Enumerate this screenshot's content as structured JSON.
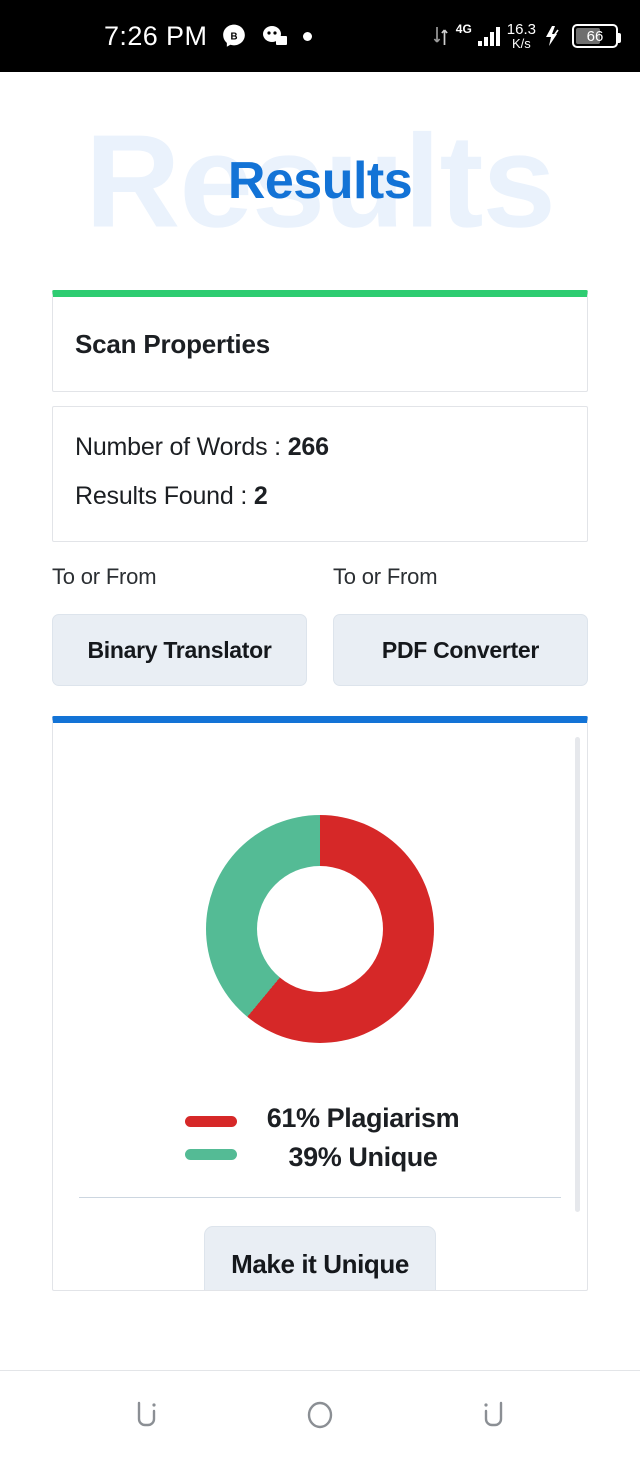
{
  "status_bar": {
    "time": "7:26 PM",
    "icons": [
      "messenger-b-icon",
      "discord-icon",
      "dot-icon"
    ],
    "network_type": "4G",
    "data_speed_value": "16.3",
    "data_speed_unit": "K/s",
    "battery_level": "66",
    "charging": true
  },
  "header": {
    "title": "Results",
    "ghost_title": "Results",
    "accent_color": "#1373d6"
  },
  "scan_properties": {
    "card_title": "Scan Properties",
    "accent_color": "#2ecc71",
    "stats": [
      {
        "label": "Number of Words : ",
        "value": "266"
      },
      {
        "label": "Results Found : ",
        "value": "2"
      }
    ]
  },
  "tools": {
    "accent_color": "#1373d6",
    "items": [
      {
        "label": "To or From",
        "button": "Binary Translator"
      },
      {
        "label": "To or From",
        "button": "PDF Converter"
      }
    ]
  },
  "chart_card": {
    "accent_color": "#1373d6",
    "action_button": "Make it Unique"
  },
  "chart_data": {
    "type": "pie",
    "variant": "donut",
    "title": "",
    "categories": [
      "Plagiarism",
      "Unique"
    ],
    "values": [
      61,
      39
    ],
    "labels": [
      "61% Plagiarism",
      "39% Unique"
    ],
    "colors": [
      "#d62828",
      "#54bb95"
    ],
    "legend_position": "bottom",
    "start_angle": 0,
    "units": "%"
  },
  "nav_bar": {
    "buttons": [
      "back-icon",
      "home-icon",
      "recents-icon"
    ]
  }
}
